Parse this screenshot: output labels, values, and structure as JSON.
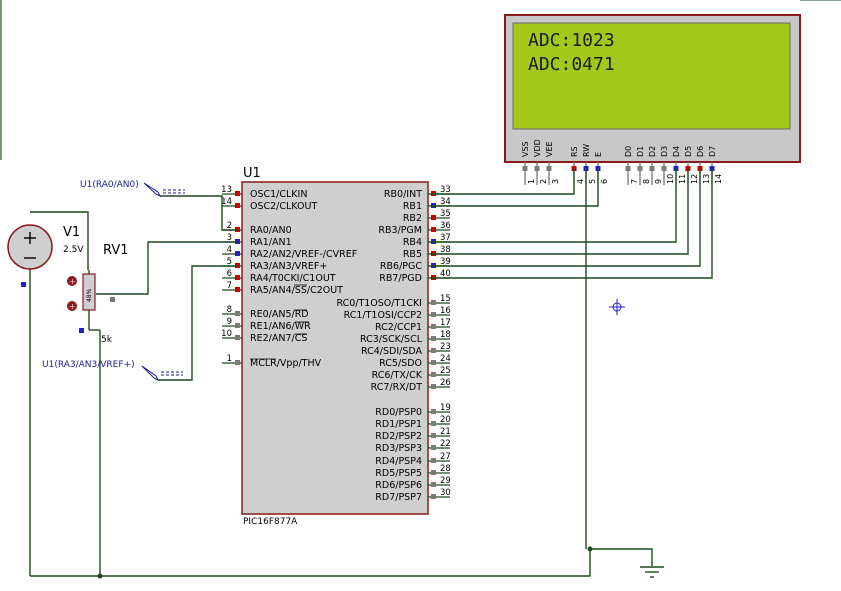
{
  "mcu": {
    "ref": "U1",
    "part": "PIC16F877A",
    "left_pins": [
      {
        "num": "13",
        "label": "OSC1/CLKIN"
      },
      {
        "num": "14",
        "label": "OSC2/CLKOUT"
      },
      {
        "num": "2",
        "label": "RA0/AN0"
      },
      {
        "num": "3",
        "label": "RA1/AN1"
      },
      {
        "num": "4",
        "label": "RA2/AN2/VREF-/CVREF"
      },
      {
        "num": "5",
        "label": "RA3/AN3/VREF+"
      },
      {
        "num": "6",
        "label": "RA4/T0CKI/C1OUT"
      },
      {
        "num": "7",
        "label": "RA5/AN4/SS/C2OUT"
      },
      {
        "num": "8",
        "label": "RE0/AN5/RD"
      },
      {
        "num": "9",
        "label": "RE1/AN6/WR"
      },
      {
        "num": "10",
        "label": "RE2/AN7/CS"
      },
      {
        "num": "1",
        "label": "MCLR/Vpp/THV"
      }
    ],
    "right_pins": [
      {
        "num": "33",
        "label": "RB0/INT"
      },
      {
        "num": "34",
        "label": "RB1"
      },
      {
        "num": "35",
        "label": "RB2"
      },
      {
        "num": "36",
        "label": "RB3/PGM"
      },
      {
        "num": "37",
        "label": "RB4"
      },
      {
        "num": "38",
        "label": "RB5"
      },
      {
        "num": "39",
        "label": "RB6/PGC"
      },
      {
        "num": "40",
        "label": "RB7/PGD"
      },
      {
        "num": "15",
        "label": "RC0/T1OSO/T1CKI"
      },
      {
        "num": "16",
        "label": "RC1/T1OSI/CCP2"
      },
      {
        "num": "17",
        "label": "RC2/CCP1"
      },
      {
        "num": "18",
        "label": "RC3/SCK/SCL"
      },
      {
        "num": "23",
        "label": "RC4/SDI/SDA"
      },
      {
        "num": "24",
        "label": "RC5/SDO"
      },
      {
        "num": "25",
        "label": "RC6/TX/CK"
      },
      {
        "num": "26",
        "label": "RC7/RX/DT"
      },
      {
        "num": "19",
        "label": "RD0/PSP0"
      },
      {
        "num": "20",
        "label": "RD1/PSP1"
      },
      {
        "num": "21",
        "label": "RD2/PSP2"
      },
      {
        "num": "22",
        "label": "RD3/PSP3"
      },
      {
        "num": "27",
        "label": "RD4/PSP4"
      },
      {
        "num": "28",
        "label": "RD5/PSP5"
      },
      {
        "num": "29",
        "label": "RD6/PSP6"
      },
      {
        "num": "30",
        "label": "RD7/PSP7"
      }
    ]
  },
  "lcd": {
    "line1": "ADC:1023",
    "line2": "ADC:0471",
    "pins": [
      {
        "name": "VSS",
        "num": "1"
      },
      {
        "name": "VDD",
        "num": "2"
      },
      {
        "name": "VEE",
        "num": "3"
      },
      {
        "name": "RS",
        "num": "4"
      },
      {
        "name": "RW",
        "num": "5"
      },
      {
        "name": "E",
        "num": "6"
      },
      {
        "name": "D0",
        "num": "7"
      },
      {
        "name": "D1",
        "num": "8"
      },
      {
        "name": "D2",
        "num": "9"
      },
      {
        "name": "D3",
        "num": "10"
      },
      {
        "name": "D4",
        "num": "11"
      },
      {
        "name": "D5",
        "num": "12"
      },
      {
        "name": "D6",
        "num": "13"
      },
      {
        "name": "D7",
        "num": "14"
      }
    ]
  },
  "source": {
    "ref": "V1",
    "value": "2.5V"
  },
  "pot": {
    "ref": "RV1",
    "value": "5k",
    "wiper": "48%"
  },
  "probes": {
    "ra0": "U1(RA0/AN0)",
    "ra3": "U1(RA3/AN3/VREF+)"
  },
  "colors": {
    "wire": "#1f4a1f",
    "body_outline": "#8b1a1a",
    "ic_fill": "#cfcfcf",
    "lcd_bezel": "#c8c8c8",
    "lcd_screen": "#a4c81a",
    "pin_red": "#cc0000",
    "pin_blue": "#2020cc",
    "probe_blue": "#1c1c8c"
  }
}
